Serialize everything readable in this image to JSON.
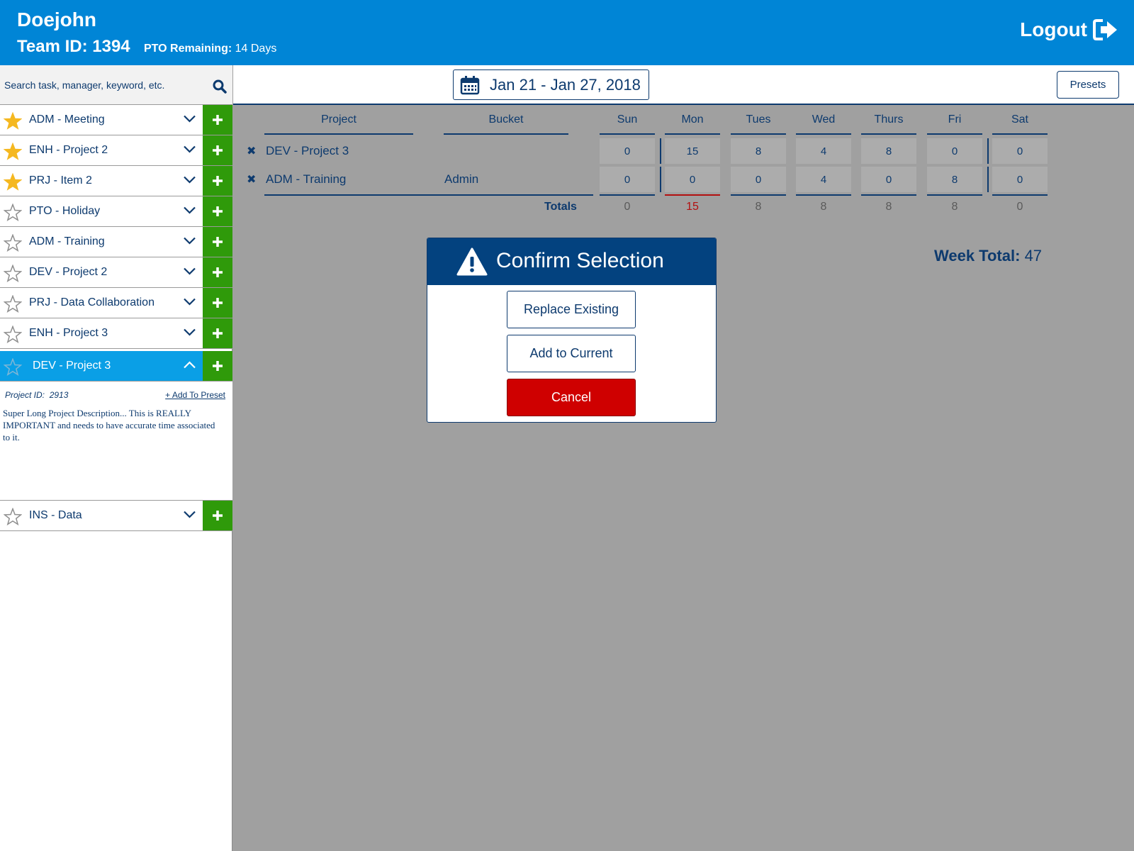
{
  "header": {
    "user_name": "Doejohn",
    "team_label": "Team ID: 1394",
    "pto_label": "PTO Remaining:",
    "pto_value": "14 Days",
    "logout_label": "Logout"
  },
  "sidebar": {
    "search_placeholder": "Search task, manager, keyword, etc.",
    "tasks": [
      {
        "label": "ADM - Meeting",
        "starred": true
      },
      {
        "label": "ENH - Project 2",
        "starred": true
      },
      {
        "label": "PRJ - Item 2",
        "starred": true
      },
      {
        "label": "PTO - Holiday",
        "starred": false
      },
      {
        "label": "ADM - Training",
        "starred": false
      },
      {
        "label": "DEV - Project 2",
        "starred": false
      },
      {
        "label": "PRJ - Data Collaboration",
        "starred": false
      },
      {
        "label": "ENH - Project 3",
        "starred": false
      },
      {
        "label": "DEV - Project 3",
        "starred": false,
        "expanded": true
      },
      {
        "label": "INS - Data",
        "starred": false
      }
    ],
    "detail": {
      "project_id_label": "Project ID:",
      "project_id": "2913",
      "add_to_preset": "+ Add To Preset",
      "description": "Super Long Project Description... This is REALLY IMPORTANT and needs to have accurate time associated to it."
    }
  },
  "topbar": {
    "date_range": "Jan 21 - Jan 27, 2018",
    "presets_label": "Presets"
  },
  "timesheet": {
    "columns": [
      "Project",
      "Bucket",
      "Sun",
      "Mon",
      "Tues",
      "Wed",
      "Thurs",
      "Fri",
      "Sat"
    ],
    "rows": [
      {
        "project": "DEV - Project 3",
        "bucket": "",
        "hours": [
          "0",
          "15",
          "8",
          "4",
          "8",
          "0",
          "0"
        ]
      },
      {
        "project": "ADM - Training",
        "bucket": "Admin",
        "hours": [
          "0",
          "0",
          "0",
          "4",
          "0",
          "8",
          "0"
        ]
      }
    ],
    "totals_label": "Totals",
    "totals": [
      "0",
      "15",
      "8",
      "8",
      "8",
      "8",
      "0"
    ],
    "week_total_label": "Week Total:",
    "week_total": "47"
  },
  "modal": {
    "title": "Confirm Selection",
    "replace_label": "Replace Existing",
    "add_label": "Add to Current",
    "cancel_label": "Cancel"
  },
  "colors": {
    "header_bg": "#0085d6",
    "navy": "#0d3a6e",
    "add_green": "#2f9a0a",
    "active_blue": "#0a9fe6",
    "star_gold": "#f5b820",
    "cancel_red": "#cf0000",
    "overlay_gray": "#a0a0a0"
  }
}
